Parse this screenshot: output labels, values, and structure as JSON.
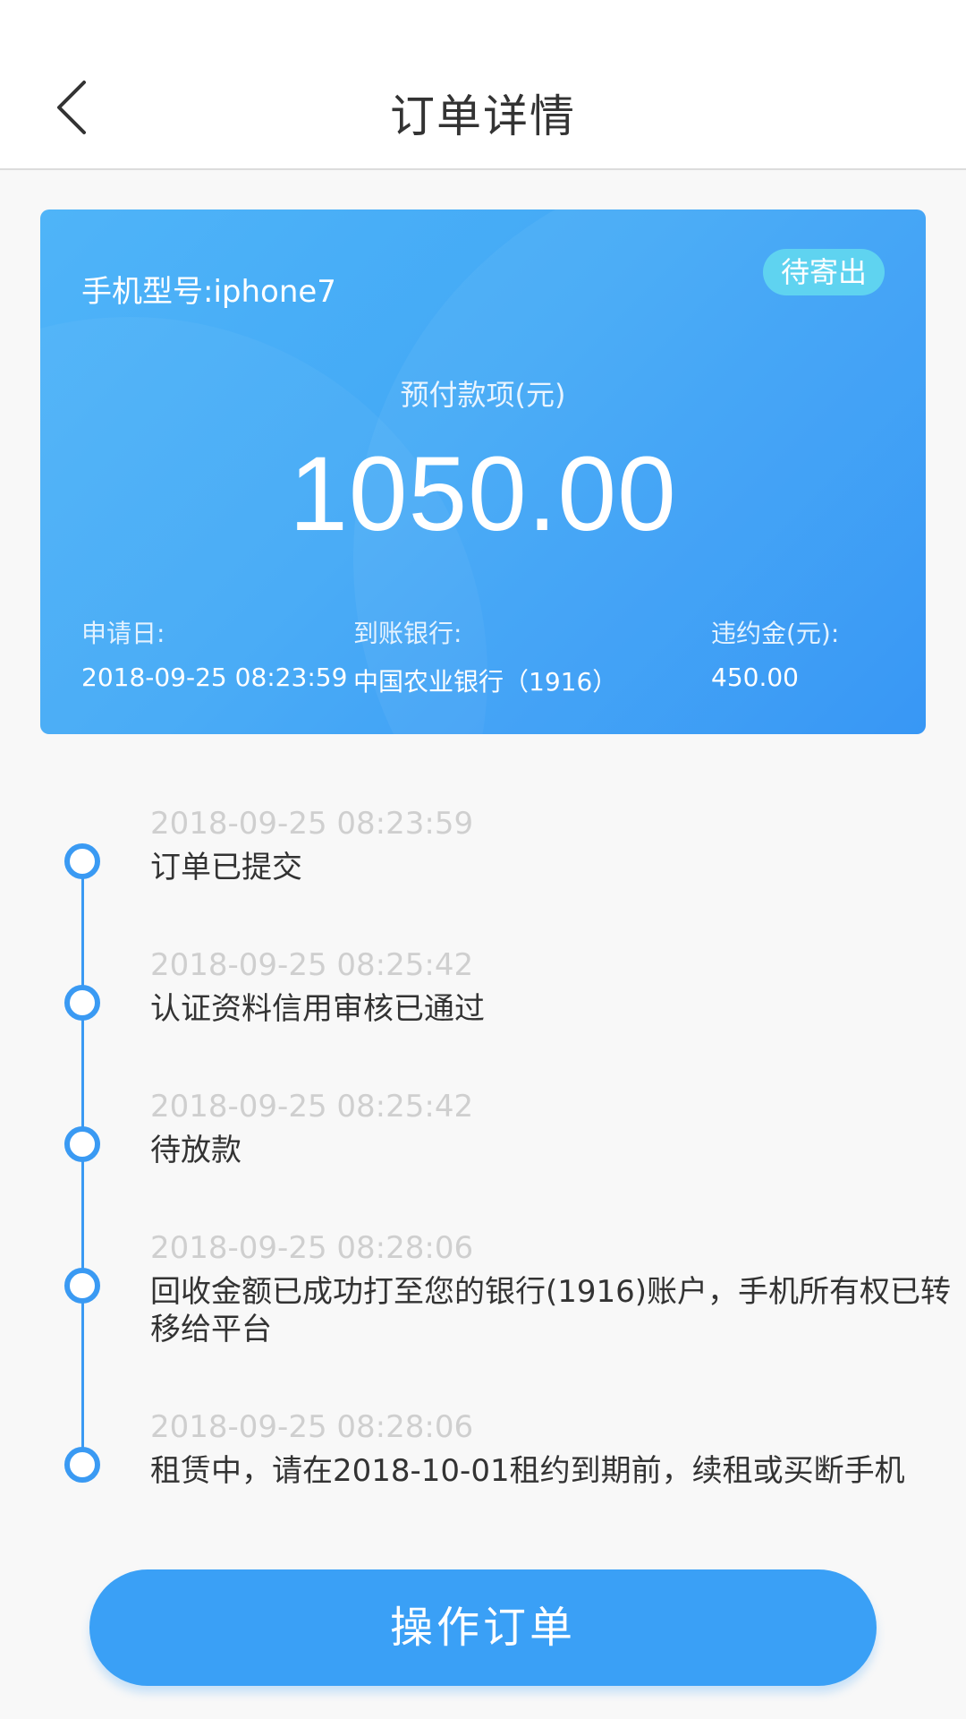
{
  "header": {
    "title": "订单详情",
    "back_icon": "chevron-left-icon"
  },
  "card": {
    "phone_model": "手机型号:iphone7",
    "status": "待寄出",
    "prepay_label": "预付款项(元)",
    "prepay_amount": "1050.00",
    "apply_date_label": "申请日:",
    "apply_date_value": "2018-09-25 08:23:59",
    "bank_label": "到账银行:",
    "bank_value": "中国农业银行（1916）",
    "penalty_label": "违约金(元):",
    "penalty_value": "450.00",
    "colors": {
      "gradient_start": "#4fb4f8",
      "gradient_end": "#2e92f5",
      "badge": "#5fd3f0"
    }
  },
  "timeline": [
    {
      "time": "2018-09-25 08:23:59",
      "text": "订单已提交"
    },
    {
      "time": "2018-09-25 08:25:42",
      "text": "认证资料信用审核已通过"
    },
    {
      "time": "2018-09-25 08:25:42",
      "text": "待放款"
    },
    {
      "time": "2018-09-25 08:28:06",
      "text": "回收金额已成功打至您的银行(1916)账户，手机所有权已转移给平台"
    },
    {
      "time": "2018-09-25 08:28:06",
      "text": "租赁中，请在2018-10-01租约到期前，续租或买断手机"
    }
  ],
  "action": {
    "label": "操作订单",
    "color": "#3aa0f6"
  }
}
